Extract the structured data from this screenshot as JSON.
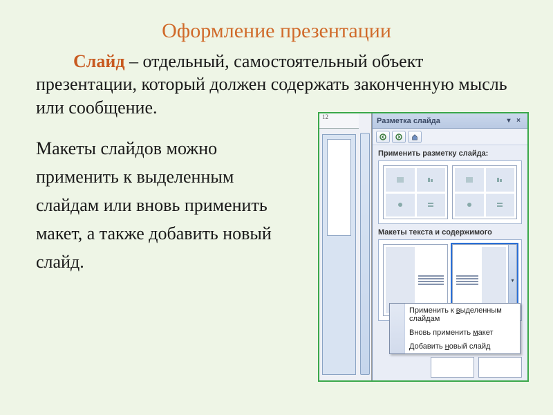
{
  "title": "Оформление презентации",
  "term": "Слайд",
  "para1_rest": " – отдельный, самостоятельный объект презентации, который должен содержать законченную мысль или сообщение.",
  "para2": "Макеты слайдов  можно применить к выделенным слайдам или вновь применить макет, а также добавить новый слайд.",
  "taskpane": {
    "title": "Разметка слайда",
    "ruler": "12",
    "section_apply": "Применить разметку слайда:",
    "section_text_content": "Макеты текста и содержимого",
    "menu": {
      "apply_selected_pre": "Применить к ",
      "apply_selected_u": "в",
      "apply_selected_post": "ыделенным слайдам",
      "reapply_pre": "Вновь применить ",
      "reapply_u": "м",
      "reapply_post": "акет",
      "add_pre": "Добавить ",
      "add_u": "н",
      "add_post": "овый слайд"
    }
  }
}
